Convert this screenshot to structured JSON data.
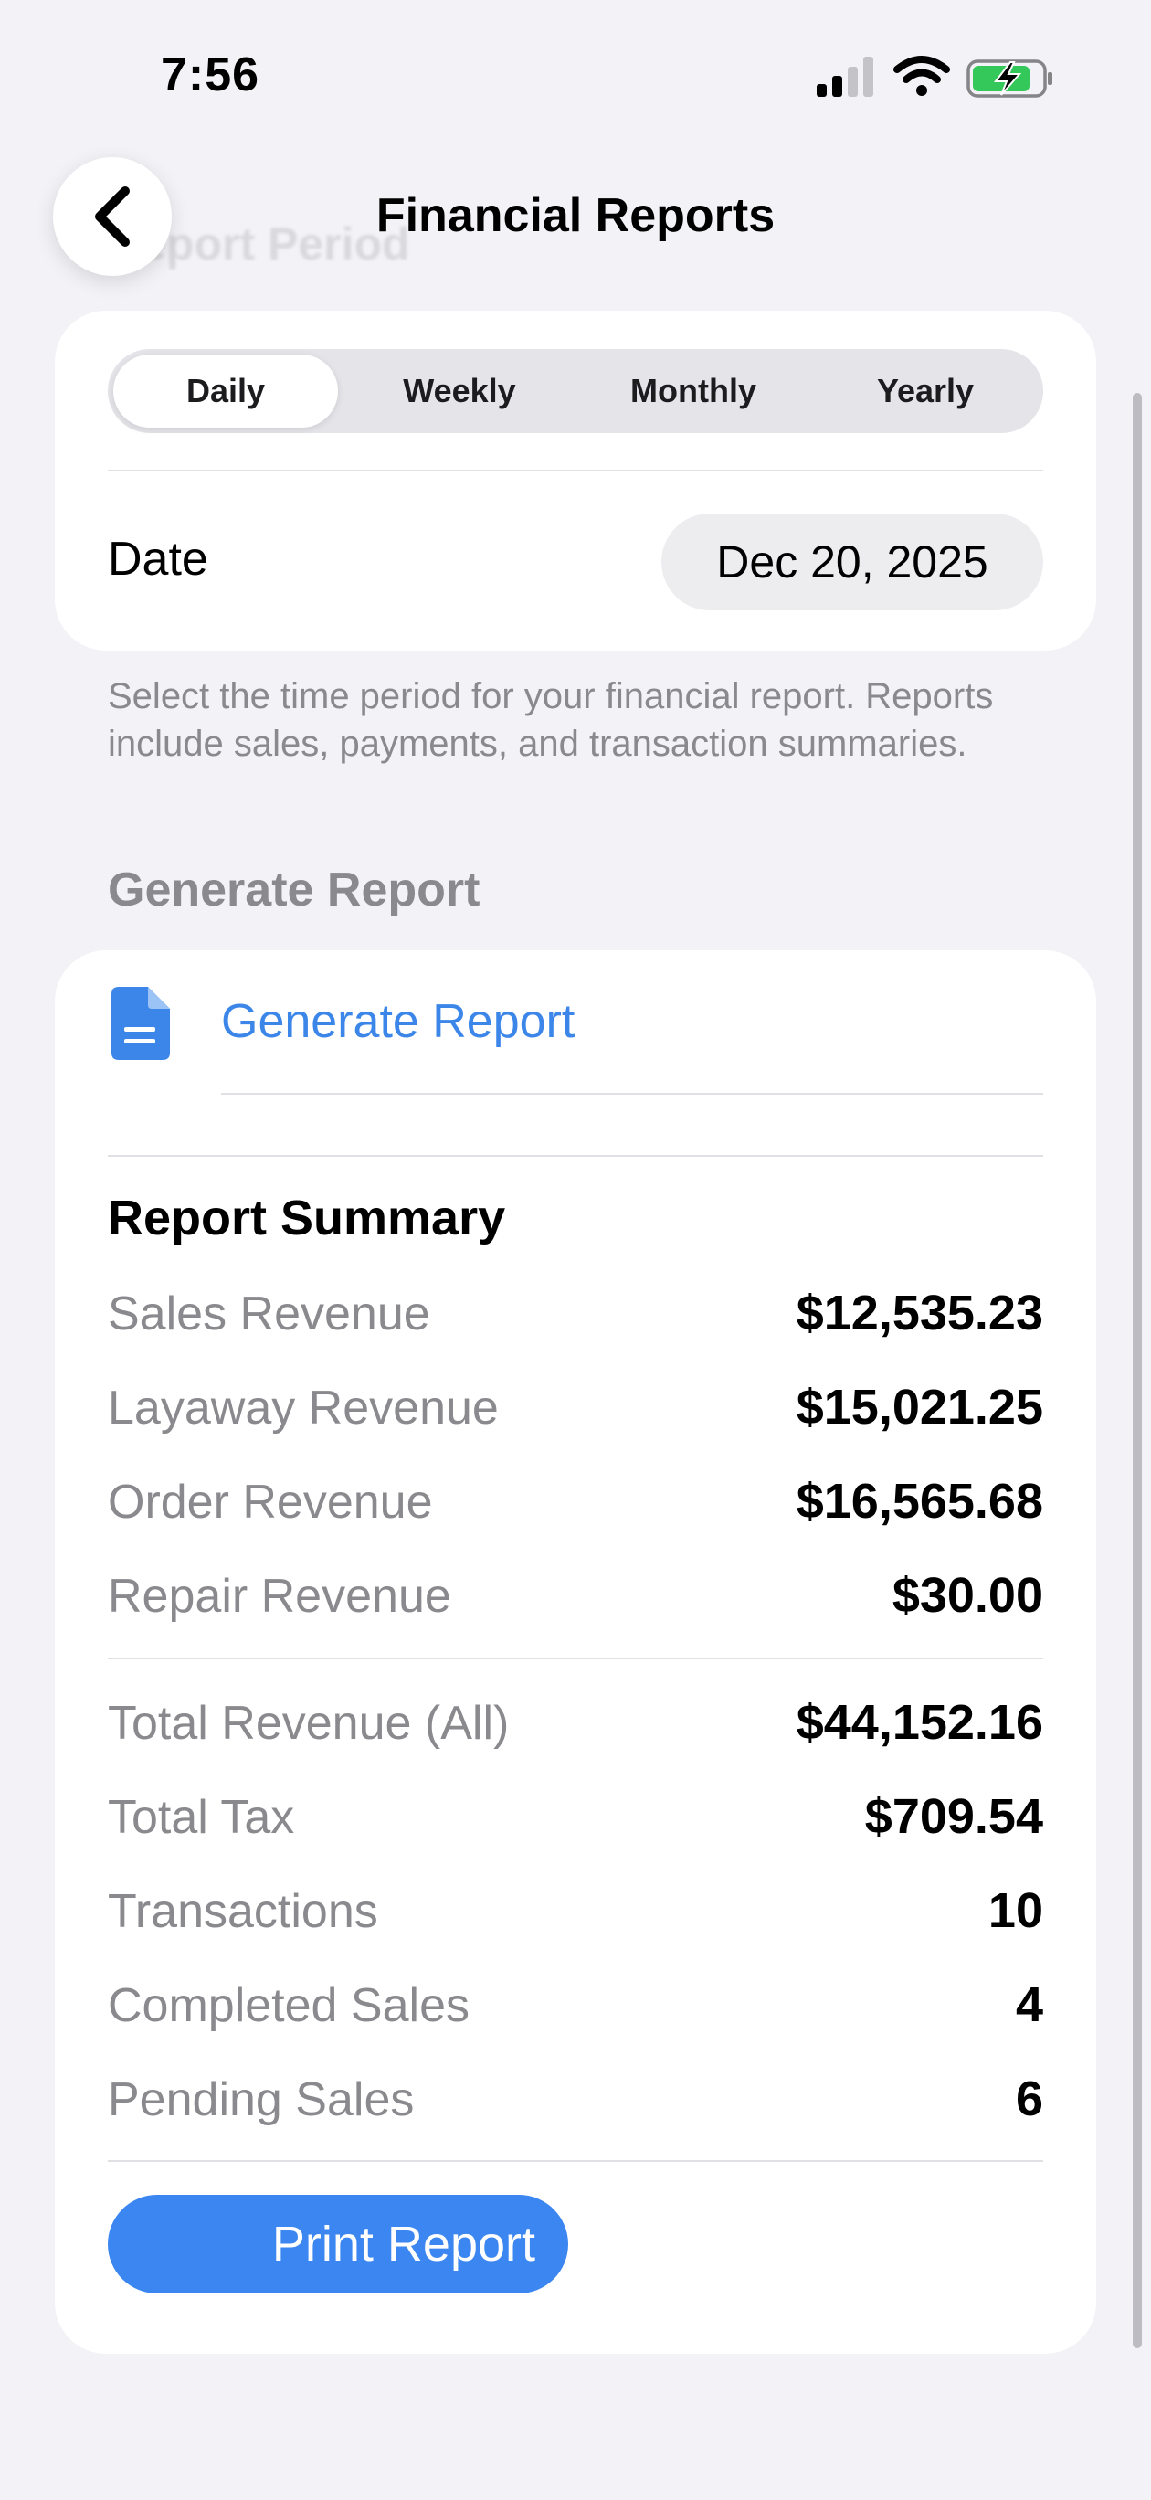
{
  "status_bar": {
    "time": "7:56",
    "signal_icon": "cellular-signal-icon",
    "wifi_icon": "wifi-icon",
    "battery_icon": "battery-charging-icon"
  },
  "nav": {
    "title": "Financial Reports",
    "faded_section_header": "Report Period",
    "back_icon": "chevron-left-icon"
  },
  "period": {
    "segments": [
      {
        "label": "Daily",
        "selected": true
      },
      {
        "label": "Weekly",
        "selected": false
      },
      {
        "label": "Monthly",
        "selected": false
      },
      {
        "label": "Yearly",
        "selected": false
      }
    ],
    "date_label": "Date",
    "date_value": "Dec 20, 2025",
    "help_text": "Select the time period for your financial report. Reports include sales, payments, and transaction summaries."
  },
  "generate": {
    "section_header": "Generate Report",
    "button_label": "Generate Report",
    "icon": "document-icon"
  },
  "summary": {
    "title": "Report Summary",
    "revenue_rows": [
      {
        "label": "Sales Revenue",
        "value": "$12,535.23"
      },
      {
        "label": "Layaway Revenue",
        "value": "$15,021.25"
      },
      {
        "label": "Order Revenue",
        "value": "$16,565.68"
      },
      {
        "label": "Repair Revenue",
        "value": "$30.00"
      }
    ],
    "total_rows": [
      {
        "label": "Total Revenue (All)",
        "value": "$44,152.16"
      },
      {
        "label": "Total Tax",
        "value": "$709.54"
      },
      {
        "label": "Transactions",
        "value": "10"
      },
      {
        "label": "Completed Sales",
        "value": "4"
      },
      {
        "label": "Pending Sales",
        "value": "6"
      }
    ],
    "print_label": "Print Report"
  },
  "colors": {
    "accent": "#3b86e8",
    "background": "#f2f2f7",
    "battery_green": "#34c759"
  }
}
